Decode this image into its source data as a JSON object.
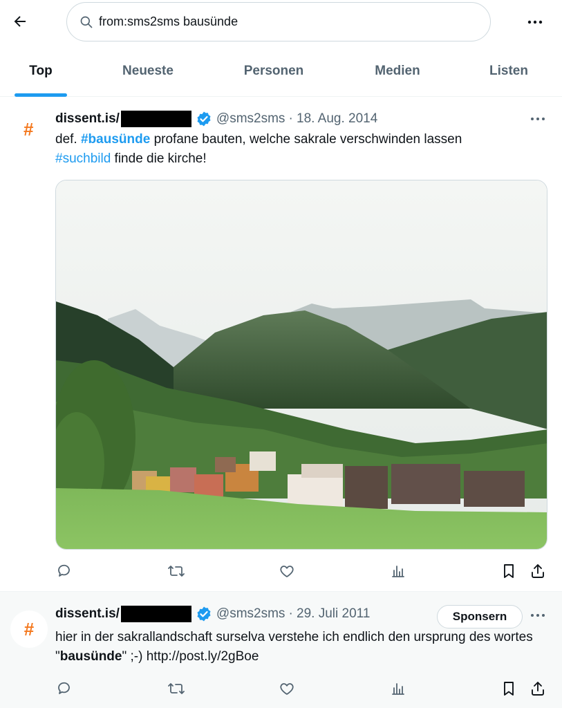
{
  "search": {
    "value": "from:sms2sms bausünde"
  },
  "tabs": [
    {
      "label": "Top",
      "active": true
    },
    {
      "label": "Neueste"
    },
    {
      "label": "Personen"
    },
    {
      "label": "Medien"
    },
    {
      "label": "Listen"
    }
  ],
  "tweets": [
    {
      "avatar": "#",
      "display_name": "dissent.is/",
      "handle": "@sms2sms",
      "date": "· 18. Aug. 2014",
      "text": {
        "pre": "def. ",
        "hashtag1": "#bausünde",
        "mid": " profane bauten, welche sakrale verschwinden lassen",
        "hashtag2": "#suchbild",
        "post": " finde die kirche!"
      }
    },
    {
      "avatar": "#",
      "display_name": "dissent.is/",
      "handle": "@sms2sms",
      "date": "· 29. Juli 2011",
      "sponsor_label": "Sponsern",
      "text": {
        "pre": "hier in der sakrallandschaft surselva verstehe ich endlich den ursprung des wortes \"",
        "bold": "bausünde",
        "post": "\" ;-) http://post.ly/2gBoe"
      }
    }
  ],
  "colors": {
    "accent": "#1d9bf0",
    "avatar_hash": "#f4791f",
    "secondary_text": "#536471"
  },
  "icons": [
    "back-arrow-icon",
    "search-icon",
    "more-icon",
    "verified-badge-icon",
    "reply-icon",
    "retweet-icon",
    "like-icon",
    "views-icon",
    "bookmark-icon",
    "share-icon"
  ]
}
